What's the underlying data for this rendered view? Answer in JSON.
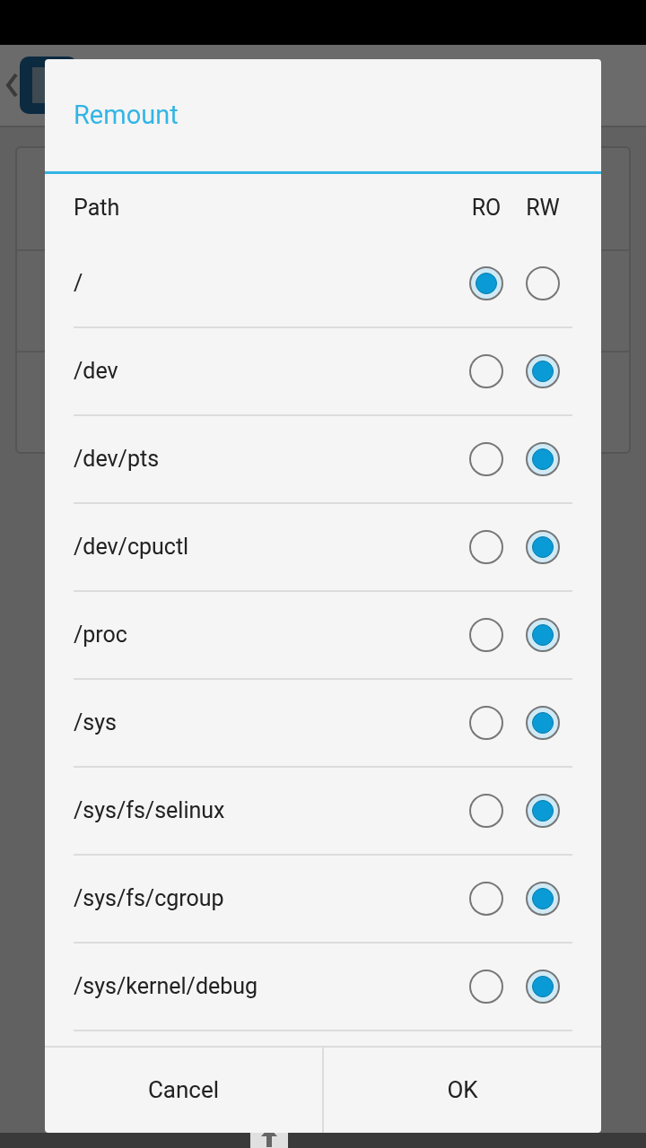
{
  "dialog": {
    "title": "Remount",
    "columns": [
      "Path",
      "RO",
      "RW"
    ],
    "mounts": [
      {
        "path": "/",
        "ro_selected": true,
        "rw_selected": false
      },
      {
        "path": "/dev",
        "ro_selected": false,
        "rw_selected": true
      },
      {
        "path": "/dev/pts",
        "ro_selected": false,
        "rw_selected": true
      },
      {
        "path": "/dev/cpuctl",
        "ro_selected": false,
        "rw_selected": true
      },
      {
        "path": "/proc",
        "ro_selected": false,
        "rw_selected": true
      },
      {
        "path": "/sys",
        "ro_selected": false,
        "rw_selected": true
      },
      {
        "path": "/sys/fs/selinux",
        "ro_selected": false,
        "rw_selected": true
      },
      {
        "path": "/sys/fs/cgroup",
        "ro_selected": false,
        "rw_selected": true
      },
      {
        "path": "/sys/kernel/debug",
        "ro_selected": false,
        "rw_selected": true
      }
    ],
    "buttons": [
      "Cancel",
      "OK"
    ]
  }
}
